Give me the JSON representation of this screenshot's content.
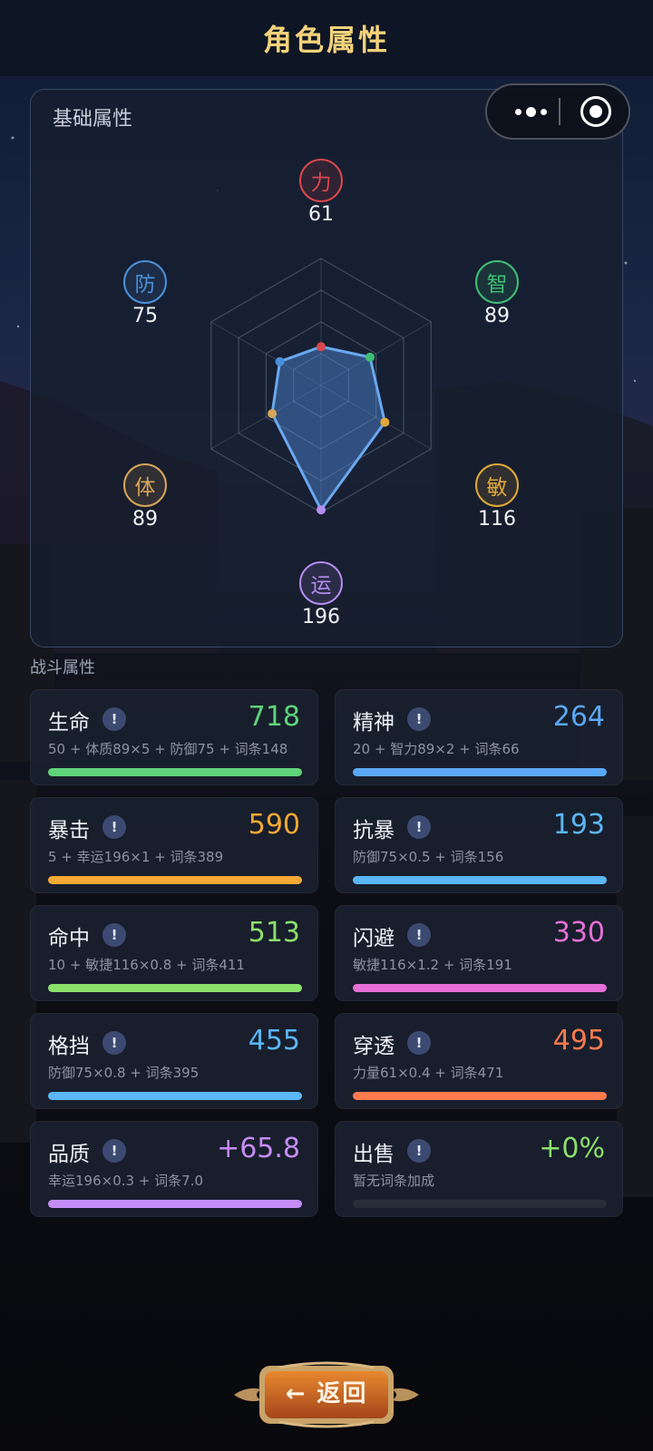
{
  "header": {
    "title": "角色属性"
  },
  "capsule": {
    "more_icon": "more-dots-icon",
    "close_icon": "target-circle-icon"
  },
  "basic": {
    "title": "基础属性",
    "attributes": [
      {
        "label": "力",
        "value": "61",
        "color": "#d9474b"
      },
      {
        "label": "智",
        "value": "89",
        "color": "#3fbf74"
      },
      {
        "label": "敏",
        "value": "116",
        "color": "#e0a83a"
      },
      {
        "label": "运",
        "value": "196",
        "color": "#b48cf0"
      },
      {
        "label": "体",
        "value": "89",
        "color": "#d8a55a"
      },
      {
        "label": "防",
        "value": "75",
        "color": "#4a90d9"
      }
    ]
  },
  "combat": {
    "title": "战斗属性",
    "stats": [
      {
        "name": "生命",
        "value": "718",
        "formula": "50 + 体质89×5 + 防御75 + 词条148",
        "color": "#5fd37a",
        "fill": 1.0
      },
      {
        "name": "精神",
        "value": "264",
        "formula": "20 + 智力89×2 + 词条66",
        "color": "#5aa8f5",
        "fill": 1.0
      },
      {
        "name": "暴击",
        "value": "590",
        "formula": "5 + 幸运196×1 + 词条389",
        "color": "#f5a833",
        "fill": 1.0
      },
      {
        "name": "抗暴",
        "value": "193",
        "formula": "防御75×0.5 + 词条156",
        "color": "#5ab6f5",
        "fill": 1.0
      },
      {
        "name": "命中",
        "value": "513",
        "formula": "10 + 敏捷116×0.8 + 词条411",
        "color": "#8be06a",
        "fill": 1.0
      },
      {
        "name": "闪避",
        "value": "330",
        "formula": "敏捷116×1.2 + 词条191",
        "color": "#e66fd8",
        "fill": 1.0
      },
      {
        "name": "格挡",
        "value": "455",
        "formula": "防御75×0.8 + 词条395",
        "color": "#5ab6f5",
        "fill": 1.0
      },
      {
        "name": "穿透",
        "value": "495",
        "formula": "力量61×0.4 + 词条471",
        "color": "#ff7a4d",
        "fill": 1.0
      },
      {
        "name": "品质",
        "value": "+65.8",
        "formula": "幸运196×0.3 + 词条7.0",
        "color": "#c58cf5",
        "fill": 1.0
      },
      {
        "name": "出售",
        "value": "+0%",
        "formula": "暂无词条加成",
        "color": "#8be06a",
        "fill": 0
      }
    ]
  },
  "footer": {
    "back_label": "← 返回"
  }
}
